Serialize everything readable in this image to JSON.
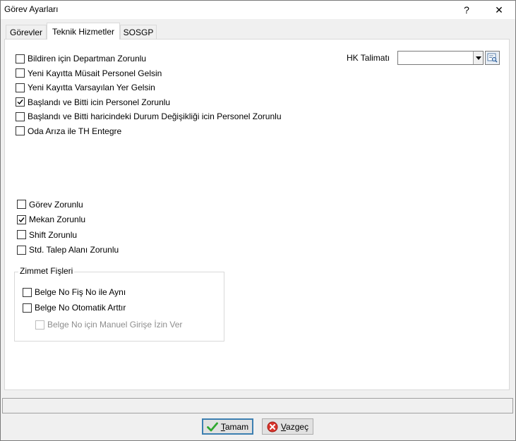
{
  "window": {
    "title": "Görev Ayarları",
    "help_label": "?",
    "close_label": "✕"
  },
  "tabs": [
    {
      "label": "Görevler",
      "active": false
    },
    {
      "label": "Teknik Hizmetler",
      "active": true
    },
    {
      "label": "SOSGP",
      "active": false
    }
  ],
  "teknik": {
    "options": [
      {
        "label": "Bildiren için Departman Zorunlu",
        "checked": false
      },
      {
        "label": "Yeni Kayıtta Müsait Personel Gelsin",
        "checked": false
      },
      {
        "label": "Yeni Kayıtta Varsayılan Yer Gelsin",
        "checked": false
      },
      {
        "label": "Başlandı ve Bitti icin Personel Zorunlu",
        "checked": true
      },
      {
        "label": "Başlandı ve Bitti haricindeki Durum Değişikliği icin Personel Zorunlu",
        "checked": false
      },
      {
        "label": "Oda Arıza ile TH Entegre",
        "checked": false
      }
    ],
    "hk_label": "HK Talimatı",
    "hk_value": "",
    "required": [
      {
        "label": "Görev Zorunlu",
        "checked": false
      },
      {
        "label": "Mekan Zorunlu",
        "checked": true
      },
      {
        "label": "Shift Zorunlu",
        "checked": false
      },
      {
        "label": "Std. Talep Alanı Zorunlu",
        "checked": false
      }
    ],
    "zimmet": {
      "title": "Zimmet Fişleri",
      "options": [
        {
          "label": "Belge No Fiş No ile Aynı",
          "checked": false,
          "disabled": false
        },
        {
          "label": "Belge No Otomatik Arttır",
          "checked": false,
          "disabled": false
        },
        {
          "label": "Belge No için Manuel Girişe İzin Ver",
          "checked": false,
          "disabled": true
        }
      ]
    }
  },
  "buttons": {
    "ok_label": "Tamam",
    "cancel_label": "Vazgeç"
  },
  "colors": {
    "ok_icon": "#2fa82f",
    "cancel_icon": "#d9342b",
    "default_border": "#3c7fb1"
  }
}
